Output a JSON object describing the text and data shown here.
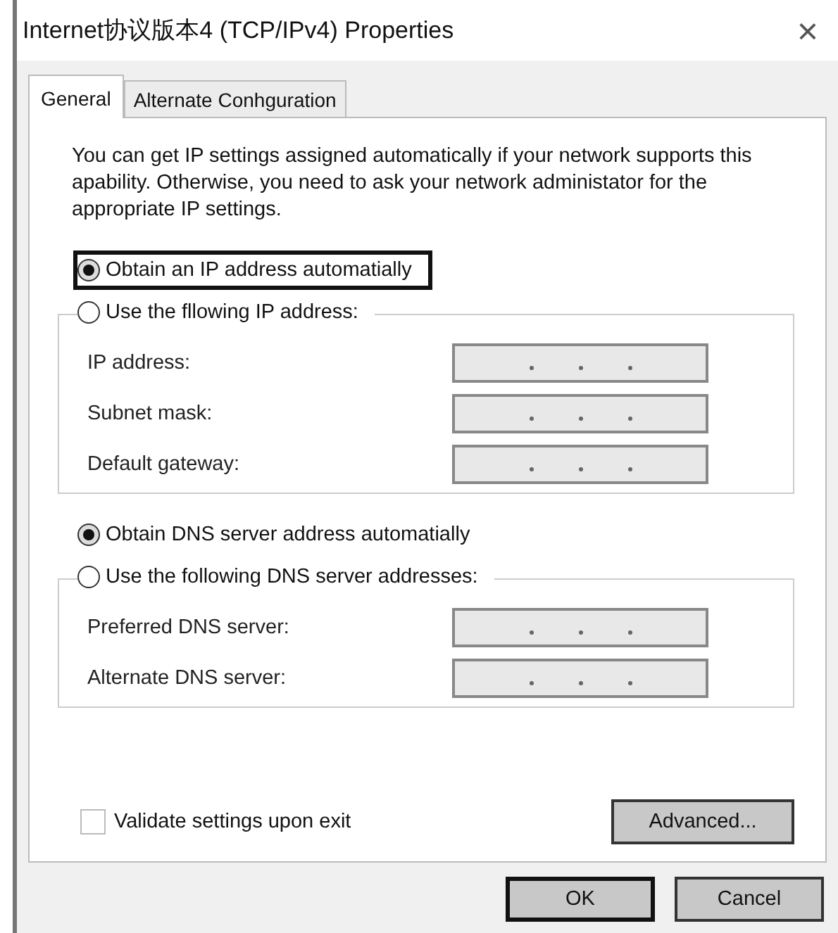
{
  "window": {
    "title": "Internet协议版本4 (TCP/IPv4) Properties",
    "close": "×"
  },
  "tabs": [
    {
      "label": "General",
      "selected": true
    },
    {
      "label": "Alternate Conhguration",
      "selected": false
    }
  ],
  "description": "You can get IP settings assigned automatically if your network supports this apability. Otherwise, you need to ask your network administator for the appropriate IP settings.",
  "ip_section": {
    "options": [
      {
        "label": "Obtain an IP address automatially",
        "selected": true,
        "highlighted": true
      },
      {
        "label": "Use the fllowing IP address:",
        "selected": false,
        "highlighted": false
      }
    ],
    "fields": [
      {
        "label": "IP address:",
        "disabled": true
      },
      {
        "label": "Subnet mask:",
        "disabled": true
      },
      {
        "label": "Default gateway:",
        "disabled": true
      }
    ]
  },
  "dns_section": {
    "options": [
      {
        "label": "Obtain DNS server address automatially",
        "selected": true,
        "highlighted": false
      },
      {
        "label": "Use the following DNS server addresses:",
        "selected": false,
        "highlighted": false
      }
    ],
    "fields": [
      {
        "label": "Preferred DNS server:",
        "disabled": true
      },
      {
        "label": "Alternate DNS server:",
        "disabled": true
      }
    ]
  },
  "validate": {
    "label": "Validate settings upon exit",
    "checked": false
  },
  "advanced_button": "Advanced...",
  "buttons": [
    {
      "label": "OK",
      "default": true
    },
    {
      "label": "Cancel",
      "default": false
    }
  ]
}
